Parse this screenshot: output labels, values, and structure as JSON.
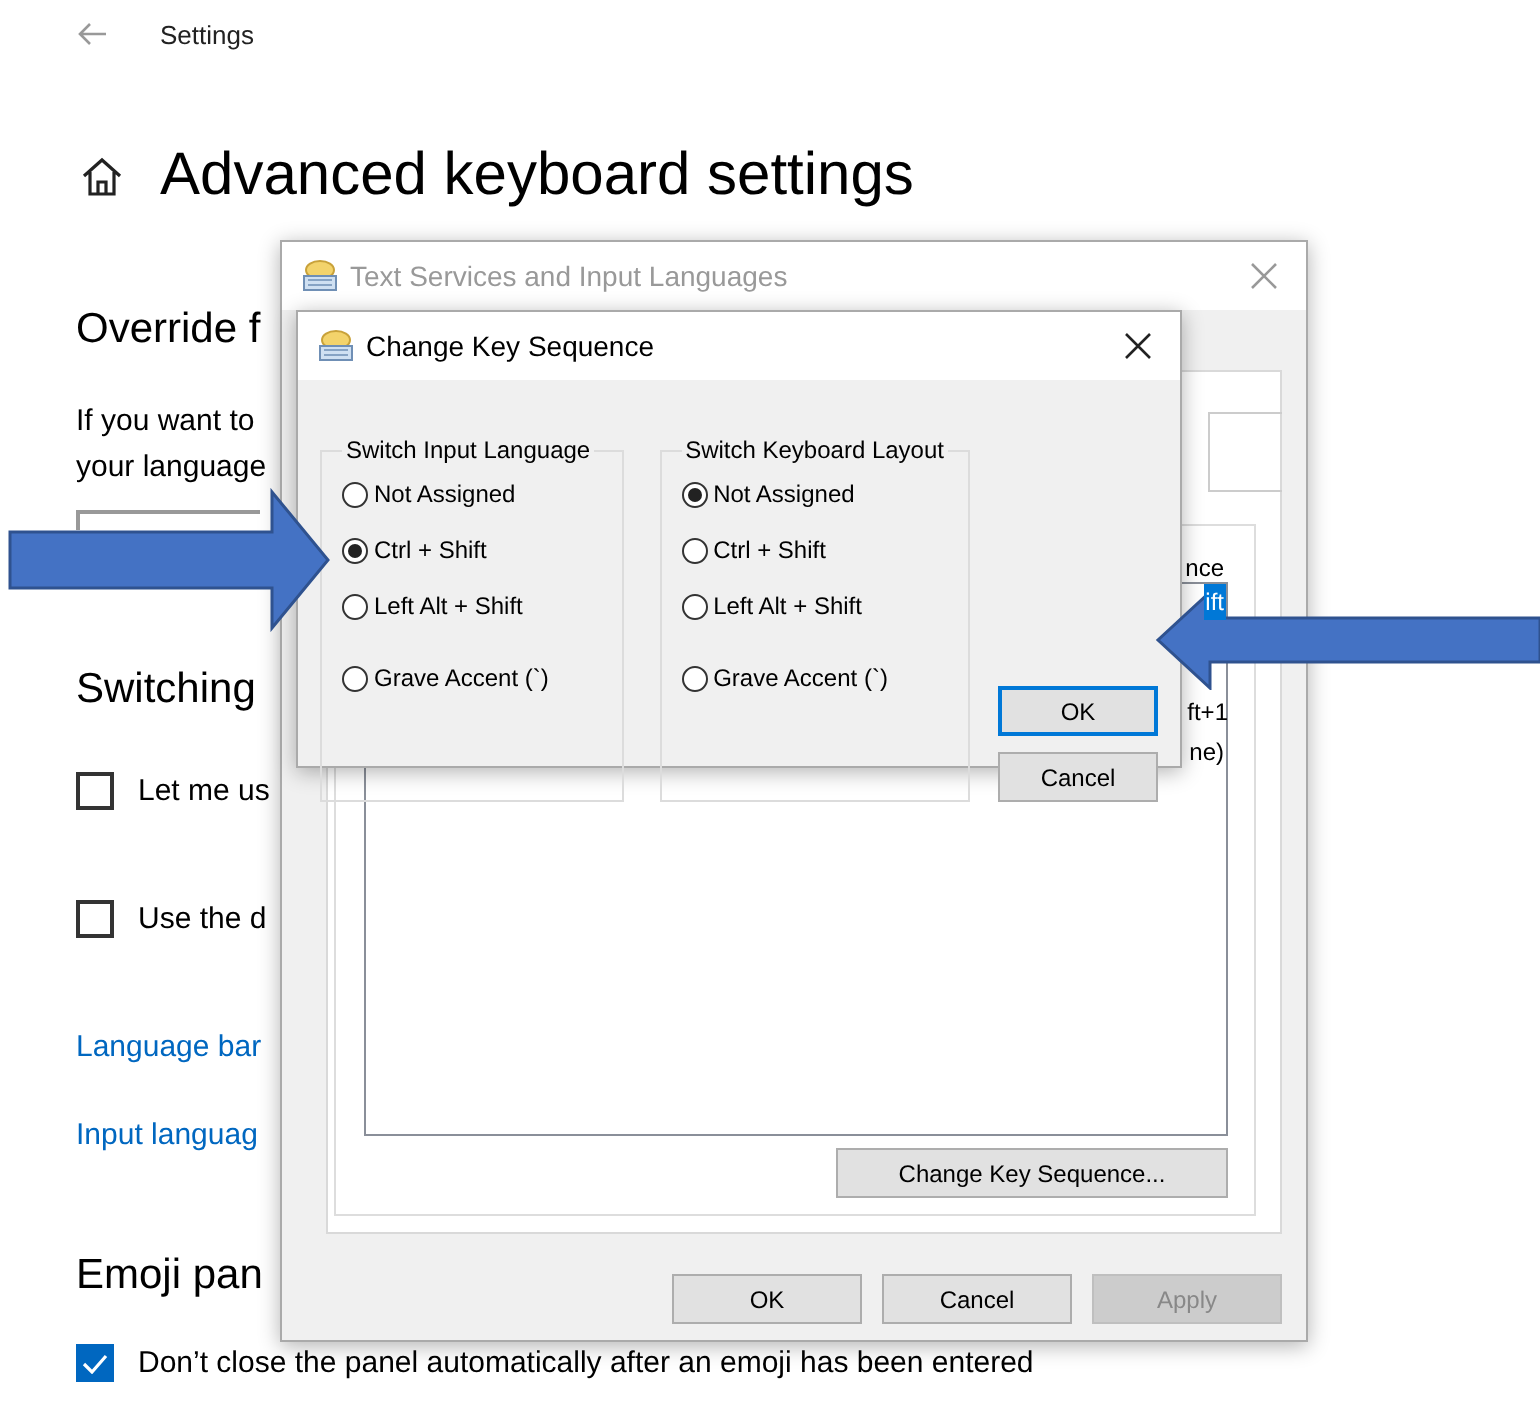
{
  "settings": {
    "header": "Settings",
    "title": "Advanced keyboard settings",
    "override_heading": "Override f",
    "override_text": [
      "If you want to",
      "your language"
    ],
    "switching_heading": "Switching",
    "checkboxes": [
      {
        "label": "Let me us",
        "checked": false
      },
      {
        "label": "Use the d",
        "checked": false
      }
    ],
    "links": [
      "Language bar",
      "Input languag"
    ],
    "emoji_heading": "Emoji pan",
    "emoji_checkbox": {
      "label": "Don’t close the panel automatically after an emoji has been entered",
      "checked": true
    }
  },
  "back_dialog": {
    "title": "Text Services and Input Languages",
    "fragments": [
      {
        "text": "nce",
        "selected": false
      },
      {
        "text": "ift",
        "selected": true
      },
      {
        "text": "ft+1",
        "selected": false
      },
      {
        "text": "ne)",
        "selected": false
      }
    ],
    "change_button": "Change Key Sequence...",
    "buttons": [
      {
        "label": "OK",
        "disabled": false
      },
      {
        "label": "Cancel",
        "disabled": false
      },
      {
        "label": "Apply",
        "disabled": true
      }
    ]
  },
  "front_dialog": {
    "title": "Change Key Sequence",
    "groups": [
      {
        "legend": "Switch Input Language",
        "options": [
          {
            "label": "Not Assigned",
            "selected": false
          },
          {
            "label": "Ctrl + Shift",
            "selected": true
          },
          {
            "label": "Left Alt + Shift",
            "selected": false
          },
          {
            "label": "Grave Accent (`)",
            "selected": false
          }
        ]
      },
      {
        "legend": "Switch Keyboard Layout",
        "options": [
          {
            "label": "Not Assigned",
            "selected": true
          },
          {
            "label": "Ctrl + Shift",
            "selected": false
          },
          {
            "label": "Left Alt + Shift",
            "selected": false
          },
          {
            "label": "Grave Accent (`)",
            "selected": false
          }
        ]
      }
    ],
    "buttons": [
      {
        "label": "OK",
        "focused": true
      },
      {
        "label": "Cancel",
        "focused": false
      }
    ]
  }
}
